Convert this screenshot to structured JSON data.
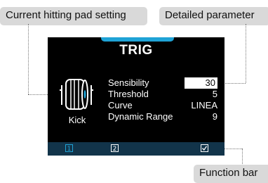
{
  "callouts": {
    "pad_setting": "Current hitting pad setting",
    "detailed_parameter": "Detailed parameter",
    "function_bar": "Function bar"
  },
  "screen": {
    "title": "TRIG",
    "pad_name": "Kick",
    "accent_color": "#1fa3d6",
    "function_bar_color": "#12344a",
    "params": [
      {
        "label": "Sensibility",
        "value": "30",
        "selected": true
      },
      {
        "label": "Threshold",
        "value": "5",
        "selected": false
      },
      {
        "label": "Curve",
        "value": "LINEA",
        "selected": false
      },
      {
        "label": "Dynamic Range",
        "value": "9",
        "selected": false
      }
    ],
    "function_bar": {
      "buttons": [
        {
          "icon": "page-1-icon",
          "digit": "1",
          "active": true
        },
        {
          "icon": "page-2-icon",
          "digit": "2",
          "active": false
        },
        {
          "icon": "checkbox-icon",
          "active": false
        }
      ]
    }
  }
}
